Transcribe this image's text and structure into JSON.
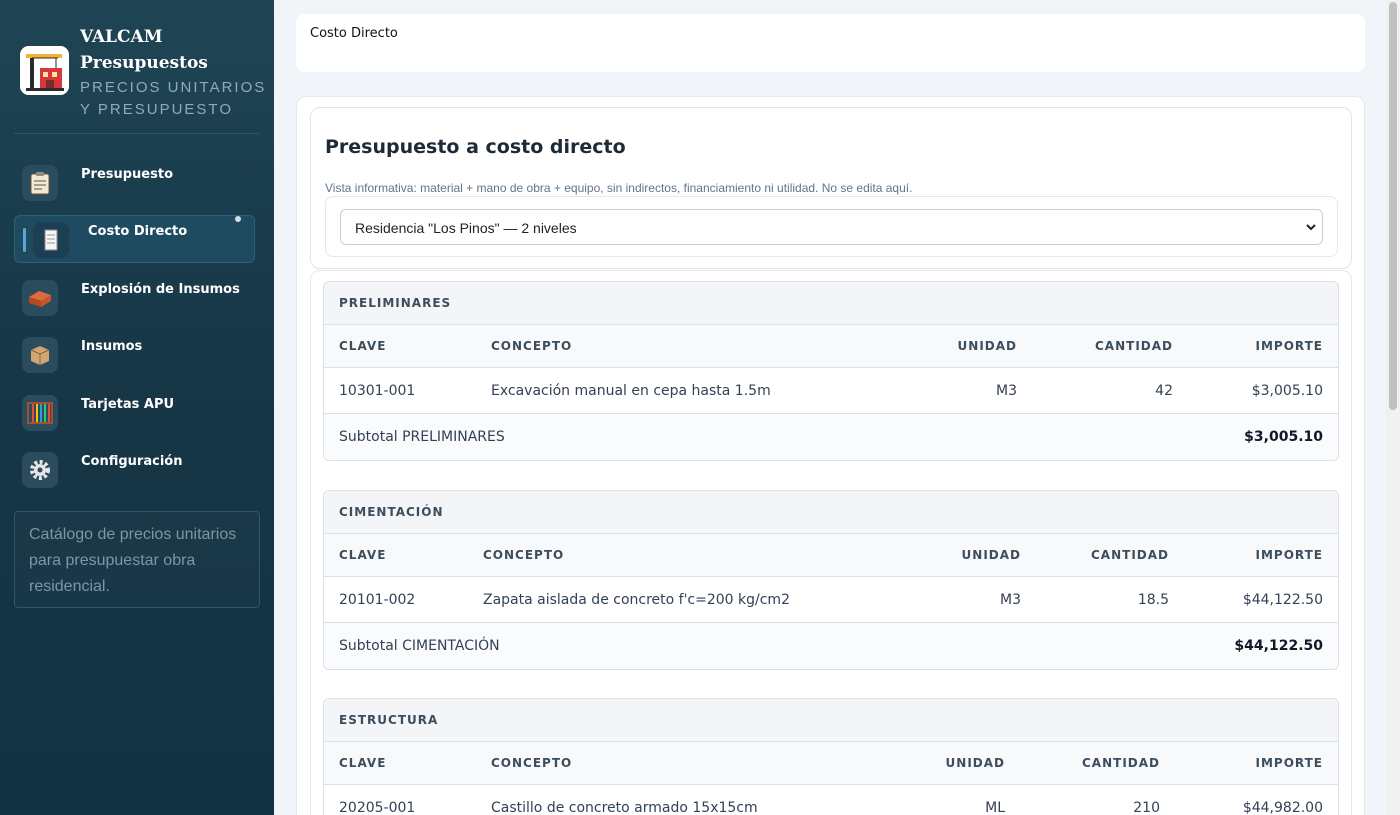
{
  "brand": {
    "title": "VALCAM Presupuestos",
    "subtitle": "PRECIOS UNITARIOS Y PRESUPUESTO",
    "logo_icon": "construction-crane-icon"
  },
  "nav": {
    "items": [
      {
        "label": "Presupuesto",
        "icon": "clipboard-icon",
        "active": false
      },
      {
        "label": "Costo Directo",
        "icon": "document-icon",
        "active": true
      },
      {
        "label": "Explosión de Insumos",
        "icon": "brick-icon",
        "active": false
      },
      {
        "label": "Insumos",
        "icon": "box-icon",
        "active": false
      },
      {
        "label": "Tarjetas APU",
        "icon": "abacus-icon",
        "active": false
      },
      {
        "label": "Configuración",
        "icon": "gear-icon",
        "active": false
      }
    ]
  },
  "sidebar_note": "Catálogo de precios unitarios para presupuestar obra residencial.",
  "header": {
    "title": "Costo Directo"
  },
  "intro": {
    "title": "Presupuesto a costo directo",
    "description": "Vista informativa: material + mano de obra + equipo, sin indirectos, financiamiento ni utilidad. No se edita aquí.",
    "project_select": {
      "value": "Residencia \"Los Pinos\" — 2 niveles"
    }
  },
  "columns": {
    "clave": "CLAVE",
    "concepto": "CONCEPTO",
    "unidad": "UNIDAD",
    "cantidad": "CANTIDAD",
    "importe": "IMPORTE"
  },
  "sections": [
    {
      "name": "PRELIMINARES",
      "rows": [
        {
          "clave": "10301-001",
          "concepto": "Excavación manual en cepa hasta 1.5m",
          "unidad": "M3",
          "cantidad": "42",
          "importe": "$3,005.10"
        }
      ],
      "subtotal_label": "Subtotal PRELIMINARES",
      "subtotal_value": "$3,005.10"
    },
    {
      "name": "CIMENTACIÓN",
      "rows": [
        {
          "clave": "20101-002",
          "concepto": "Zapata aislada de concreto f'c=200 kg/cm2",
          "unidad": "M3",
          "cantidad": "18.5",
          "importe": "$44,122.50"
        }
      ],
      "subtotal_label": "Subtotal CIMENTACIÓN",
      "subtotal_value": "$44,122.50"
    },
    {
      "name": "ESTRUCTURA",
      "rows": [
        {
          "clave": "20205-001",
          "concepto": "Castillo de concreto armado 15x15cm",
          "unidad": "ML",
          "cantidad": "210",
          "importe": "$44,982.00"
        }
      ],
      "subtotal_label": "",
      "subtotal_value": ""
    }
  ],
  "colors": {
    "sidebar": "#173747",
    "accent": "#5aa6d6",
    "background": "#f1f5f9"
  }
}
